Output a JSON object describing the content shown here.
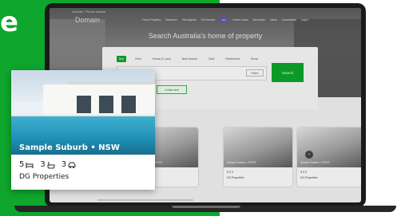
{
  "headline_fragment": "e",
  "laptop": {
    "screen": {
      "promo_text": "Domain · Promo banner",
      "logo": "Domain",
      "nav": [
        "Find a Property",
        "Research",
        "Find Agents",
        "For Owners",
        "New",
        "Home Loans",
        "Innovation",
        "News",
        "Commercial",
        "Log in"
      ],
      "hero_title": "Search Australia's home of property",
      "tabs": [
        "Buy",
        "Rent",
        "House & Land",
        "New Homes",
        "Sold",
        "Retirement",
        "Rural"
      ],
      "search_placeholder": "Try a location or a school or project name",
      "filters_label": "Filters",
      "search_button_label": "Search",
      "alert_button_label": "Create alert",
      "mini_cards": [
        {
          "label": "Sample Suburb • STATE",
          "features": "5 3 3",
          "agency": "DG Properties"
        },
        {
          "label": "Sample Suburb • STATE",
          "features": "5 3 3",
          "agency": "DG Properties"
        },
        {
          "label": "Sample Suburb • STATE",
          "features": "5 3 3",
          "agency": "DG Properties"
        }
      ],
      "next_arrow": "›"
    }
  },
  "featured_card": {
    "location": "Sample Suburb • NSW",
    "beds": "5",
    "baths": "3",
    "parking": "3",
    "agency": "DG Properties",
    "icons": [
      "bed-icon",
      "bath-icon",
      "car-icon"
    ]
  },
  "colors": {
    "brand_green": "#0ea62c",
    "card_white": "#ffffff"
  }
}
